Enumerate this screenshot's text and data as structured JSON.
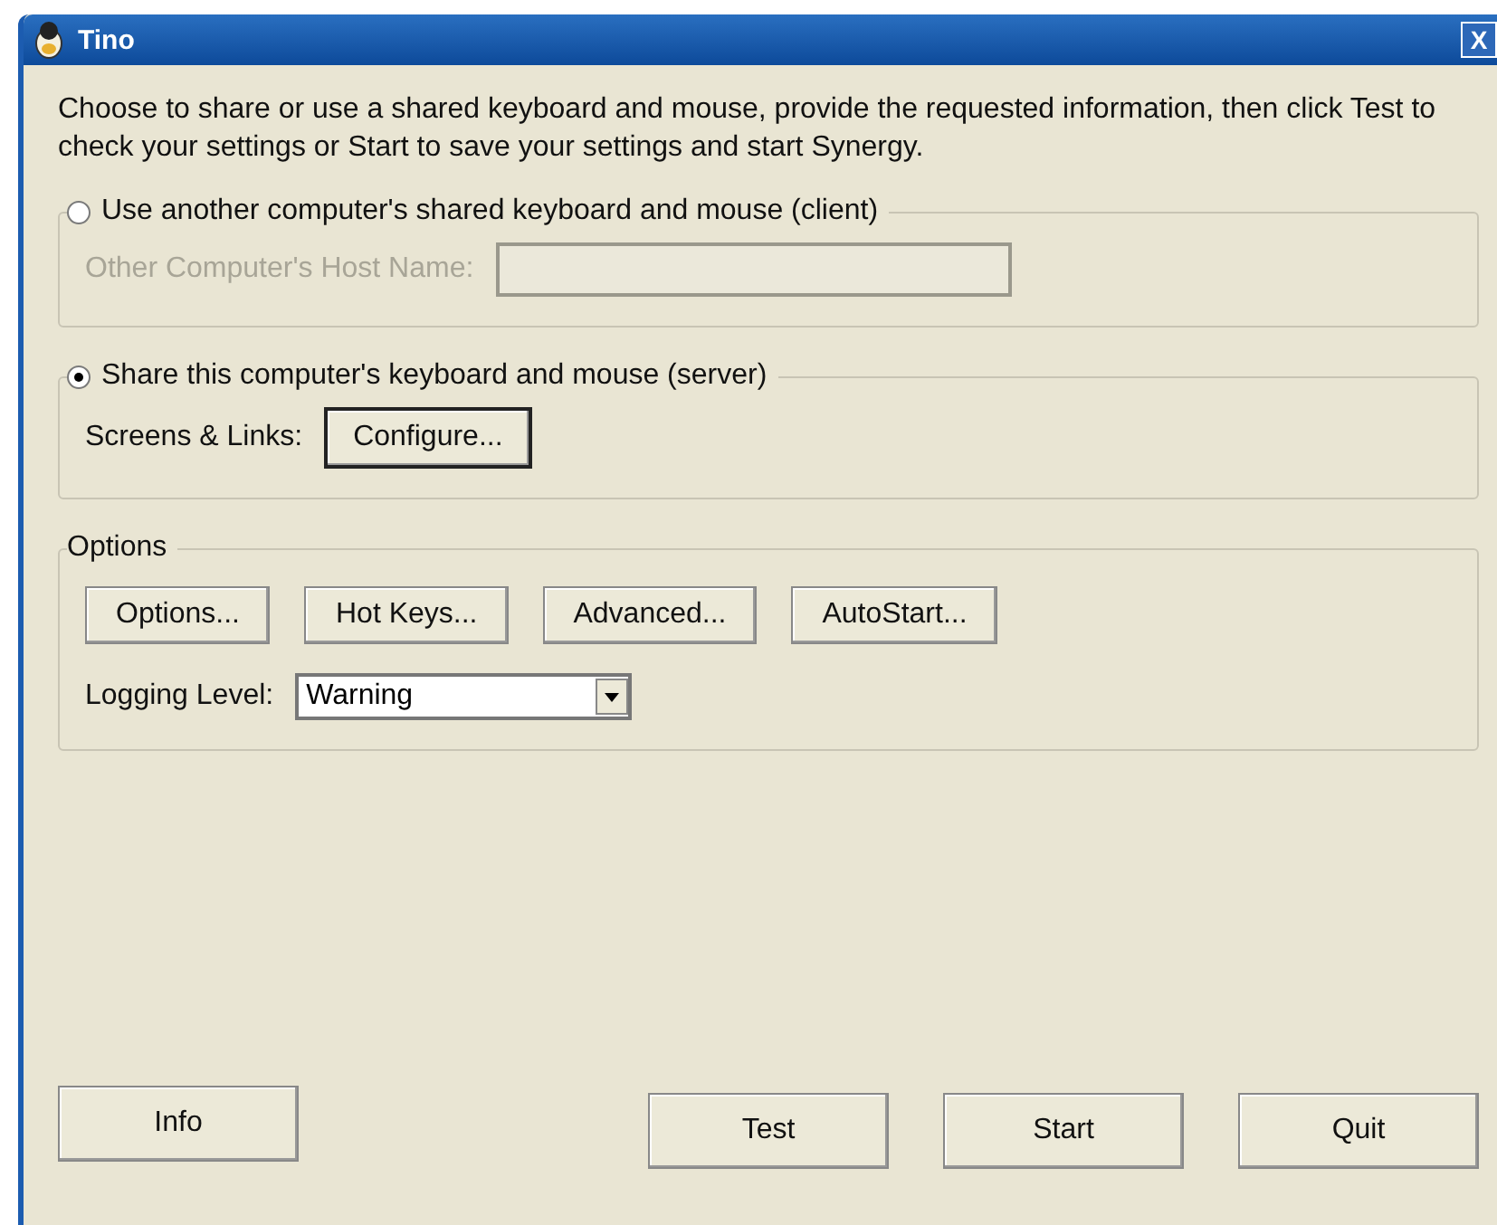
{
  "window": {
    "title": "Tino",
    "close": "X"
  },
  "instructions": "Choose to share or use a shared keyboard and mouse, provide the requested information, then click Test to check your settings or Start to save your settings and start Synergy.",
  "modes": [
    {
      "kind": "host",
      "label": "Use another computer's shared keyboard and mouse (client)",
      "selected": false,
      "field_label": "Other Computer's Host Name:",
      "disabled": true
    },
    {
      "kind": "configure",
      "label": "Share this computer's keyboard and mouse (server)",
      "selected": true,
      "field_label": "Screens & Links:",
      "button": "Configure...",
      "disabled": false
    }
  ],
  "options": {
    "title": "Options",
    "buttons": [
      "Options...",
      "Hot Keys...",
      "Advanced...",
      "AutoStart..."
    ],
    "logging_label": "Logging Level:",
    "logging_value": "Warning"
  },
  "footer": {
    "left": [
      "Info"
    ],
    "right": [
      "Test",
      "Start",
      "Quit"
    ]
  }
}
